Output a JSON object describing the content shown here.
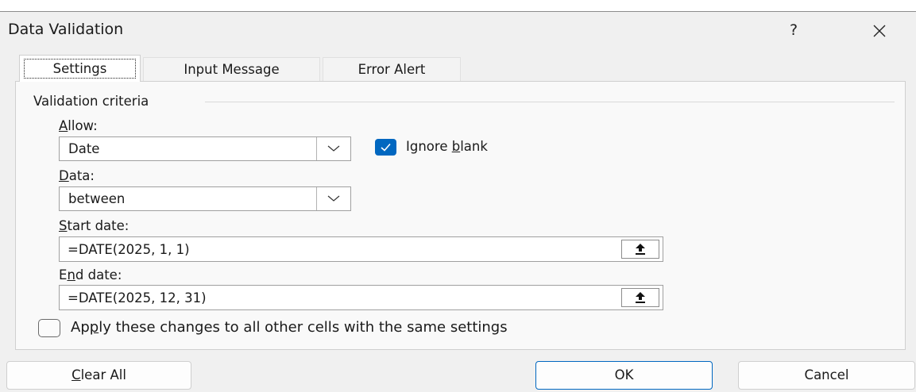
{
  "dialog": {
    "title": "Data Validation",
    "help": "?",
    "close_icon": "close-icon",
    "accent_color": "#0067c0"
  },
  "tabs": [
    {
      "label": "Settings",
      "active": true
    },
    {
      "label": "Input Message",
      "active": false
    },
    {
      "label": "Error Alert",
      "active": false
    }
  ],
  "criteria": {
    "group_label": "Validation criteria",
    "allow": {
      "label_access": "A",
      "label_rest": "llow:",
      "value": "Date"
    },
    "ignore_blank": {
      "label_pre": "Ignore ",
      "label_access": "b",
      "label_post": "lank",
      "checked": true
    },
    "data": {
      "label_access": "D",
      "label_rest": "ata:",
      "value": "between"
    },
    "start_date": {
      "label_access": "S",
      "label_rest": "tart date:",
      "value": "=DATE(2025, 1, 1)"
    },
    "end_date": {
      "label_pre": "E",
      "label_access": "n",
      "label_post": "d date:",
      "value": "=DATE(2025, 12, 31)"
    }
  },
  "apply_all": {
    "label_pre": "Ap",
    "label_access": "p",
    "label_post": "ly these changes to all other cells with the same settings",
    "checked": false
  },
  "buttons": {
    "clear_all": {
      "access": "C",
      "rest": "lear All"
    },
    "ok": "OK",
    "cancel": "Cancel"
  }
}
